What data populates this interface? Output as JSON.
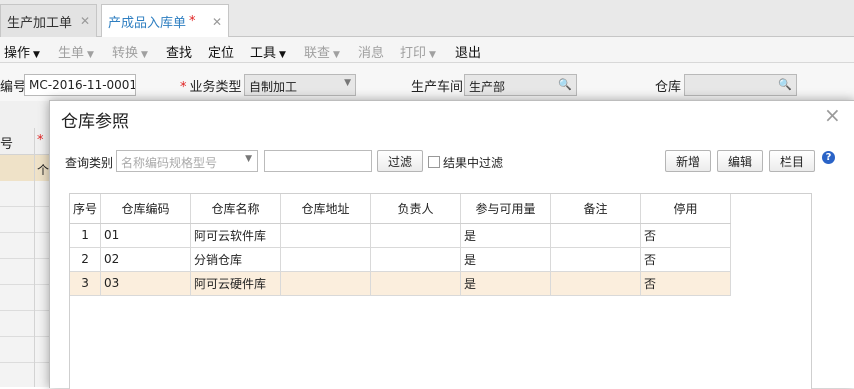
{
  "tabs": [
    {
      "label": "生产加工单",
      "close": "✕"
    },
    {
      "label": "产成品入库单",
      "modified": "*",
      "close": "✕"
    }
  ],
  "menu": {
    "operate": "操作",
    "generate": "生单",
    "convert": "转换",
    "find": "查找",
    "locate": "定位",
    "tools": "工具",
    "linkquery": "联查",
    "message": "消息",
    "print": "打印",
    "exit": "退出"
  },
  "form": {
    "doc_no_label": "编号",
    "doc_no_value": "MC-2016-11-0001",
    "biz_type_label": "业务类型",
    "biz_type_value": "自制加工",
    "workshop_label": "生产车间",
    "workshop_value": "生产部",
    "warehouse_label": "仓库",
    "warehouse_value": ""
  },
  "background_grid": {
    "col1_header": "号",
    "row1_text": "个"
  },
  "dialog": {
    "title": "仓库参照",
    "close": "×",
    "query_label": "查询类别",
    "query_placeholder": "名称编码规格型号",
    "query_input_value": "",
    "filter_button": "过滤",
    "filter_in_results_label": "结果中过滤",
    "filter_in_results_checked": false,
    "add_button": "新增",
    "edit_button": "编辑",
    "columns_button": "栏目",
    "help_icon": "?",
    "columns": [
      "序号",
      "仓库编码",
      "仓库名称",
      "仓库地址",
      "负责人",
      "参与可用量",
      "备注",
      "停用"
    ],
    "rows": [
      {
        "seq": "1",
        "code": "01",
        "name": "阿可云软件库",
        "address": "",
        "manager": "",
        "available": "是",
        "remark": "",
        "disabled": "否"
      },
      {
        "seq": "2",
        "code": "02",
        "name": "分销仓库",
        "address": "",
        "manager": "",
        "available": "是",
        "remark": "",
        "disabled": "否"
      },
      {
        "seq": "3",
        "code": "03",
        "name": "阿可云硬件库",
        "address": "",
        "manager": "",
        "available": "是",
        "remark": "",
        "disabled": "否"
      }
    ],
    "selected_row": 3
  },
  "colors": {
    "active_tab_text": "#2f7fc1",
    "required_star": "#e02020",
    "selected_row": "#fbeedd",
    "help_icon": "#2a63c7"
  }
}
